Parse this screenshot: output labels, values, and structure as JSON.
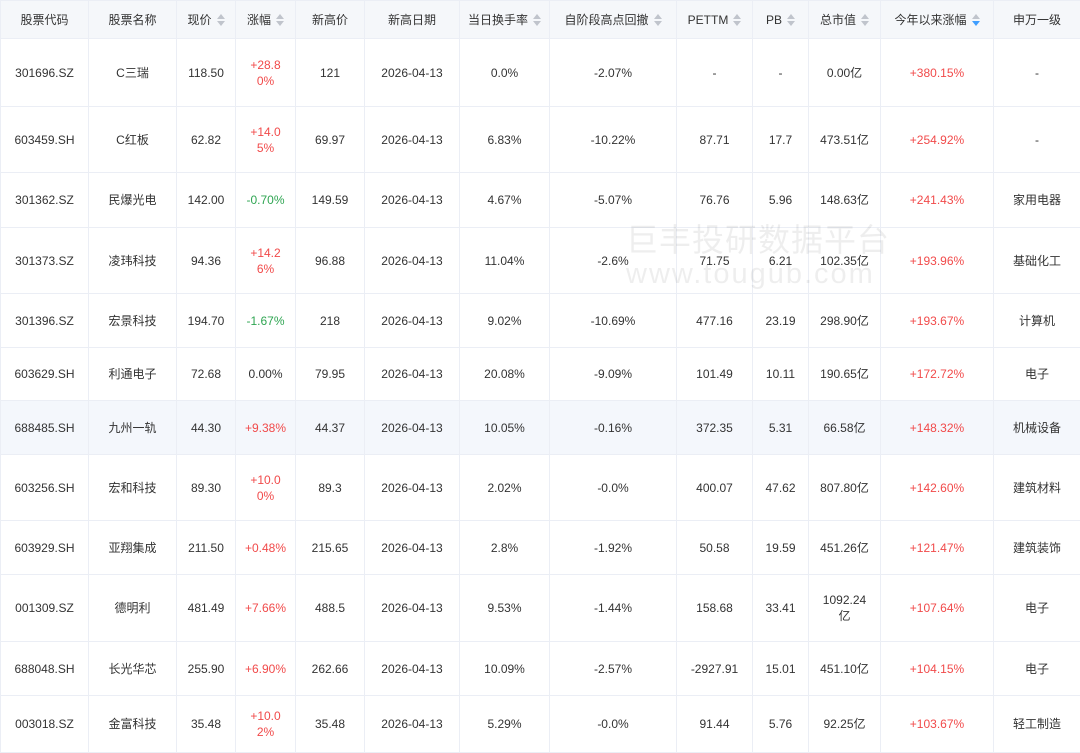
{
  "colors": {
    "up": "#f14a4a",
    "down": "#2fa552",
    "text": "#333333",
    "header_bg": "#f5f7fa",
    "border": "#ebeef5",
    "row_highlight": "#f4f7fc",
    "sort_inactive": "#c0c4cc",
    "sort_active": "#409eff"
  },
  "watermark": {
    "title": "巨丰投研数据平台",
    "url": "www.tougub.com"
  },
  "table": {
    "columns": [
      {
        "label": "股票代码",
        "sortable": false
      },
      {
        "label": "股票名称",
        "sortable": false
      },
      {
        "label": "现价",
        "sortable": true
      },
      {
        "label": "涨幅",
        "sortable": true
      },
      {
        "label": "新高价",
        "sortable": false
      },
      {
        "label": "新高日期",
        "sortable": false
      },
      {
        "label": "当日换手率",
        "sortable": true
      },
      {
        "label": "自阶段高点回撤",
        "sortable": true
      },
      {
        "label": "PETTM",
        "sortable": true
      },
      {
        "label": "PB",
        "sortable": true
      },
      {
        "label": "总市值",
        "sortable": true
      },
      {
        "label": "今年以来涨幅",
        "sortable": true,
        "sorted_descending": true
      },
      {
        "label": "申万一级",
        "sortable": false
      }
    ],
    "rows": [
      {
        "code": "301696.SZ",
        "name": "C三瑞",
        "price": "118.50",
        "change": "+28.80%",
        "high_price": "121",
        "high_date": "2026-04-13",
        "turnover": "0.0%",
        "drawdown": "-2.07%",
        "pe_ttm": "-",
        "pb": "-",
        "market_cap": "0.00亿",
        "ytd_change": "+380.15%",
        "sector": "-"
      },
      {
        "code": "603459.SH",
        "name": "C红板",
        "price": "62.82",
        "change": "+14.05%",
        "high_price": "69.97",
        "high_date": "2026-04-13",
        "turnover": "6.83%",
        "drawdown": "-10.22%",
        "pe_ttm": "87.71",
        "pb": "17.7",
        "market_cap": "473.51亿",
        "ytd_change": "+254.92%",
        "sector": "-"
      },
      {
        "code": "301362.SZ",
        "name": "民爆光电",
        "price": "142.00",
        "change": "-0.70%",
        "high_price": "149.59",
        "high_date": "2026-04-13",
        "turnover": "4.67%",
        "drawdown": "-5.07%",
        "pe_ttm": "76.76",
        "pb": "5.96",
        "market_cap": "148.63亿",
        "ytd_change": "+241.43%",
        "sector": "家用电器"
      },
      {
        "code": "301373.SZ",
        "name": "凌玮科技",
        "price": "94.36",
        "change": "+14.26%",
        "high_price": "96.88",
        "high_date": "2026-04-13",
        "turnover": "11.04%",
        "drawdown": "-2.6%",
        "pe_ttm": "71.75",
        "pb": "6.21",
        "market_cap": "102.35亿",
        "ytd_change": "+193.96%",
        "sector": "基础化工"
      },
      {
        "code": "301396.SZ",
        "name": "宏景科技",
        "price": "194.70",
        "change": "-1.67%",
        "high_price": "218",
        "high_date": "2026-04-13",
        "turnover": "9.02%",
        "drawdown": "-10.69%",
        "pe_ttm": "477.16",
        "pb": "23.19",
        "market_cap": "298.90亿",
        "ytd_change": "+193.67%",
        "sector": "计算机"
      },
      {
        "code": "603629.SH",
        "name": "利通电子",
        "price": "72.68",
        "change": "0.00%",
        "high_price": "79.95",
        "high_date": "2026-04-13",
        "turnover": "20.08%",
        "drawdown": "-9.09%",
        "pe_ttm": "101.49",
        "pb": "10.11",
        "market_cap": "190.65亿",
        "ytd_change": "+172.72%",
        "sector": "电子"
      },
      {
        "code": "688485.SH",
        "name": "九州一轨",
        "price": "44.30",
        "change": "+9.38%",
        "high_price": "44.37",
        "high_date": "2026-04-13",
        "turnover": "10.05%",
        "drawdown": "-0.16%",
        "pe_ttm": "372.35",
        "pb": "5.31",
        "market_cap": "66.58亿",
        "ytd_change": "+148.32%",
        "sector": "机械设备",
        "highlighted": true
      },
      {
        "code": "603256.SH",
        "name": "宏和科技",
        "price": "89.30",
        "change": "+10.00%",
        "high_price": "89.3",
        "high_date": "2026-04-13",
        "turnover": "2.02%",
        "drawdown": "-0.0%",
        "pe_ttm": "400.07",
        "pb": "47.62",
        "market_cap": "807.80亿",
        "ytd_change": "+142.60%",
        "sector": "建筑材料"
      },
      {
        "code": "603929.SH",
        "name": "亚翔集成",
        "price": "211.50",
        "change": "+0.48%",
        "high_price": "215.65",
        "high_date": "2026-04-13",
        "turnover": "2.8%",
        "drawdown": "-1.92%",
        "pe_ttm": "50.58",
        "pb": "19.59",
        "market_cap": "451.26亿",
        "ytd_change": "+121.47%",
        "sector": "建筑装饰"
      },
      {
        "code": "001309.SZ",
        "name": "德明利",
        "price": "481.49",
        "change": "+7.66%",
        "high_price": "488.5",
        "high_date": "2026-04-13",
        "turnover": "9.53%",
        "drawdown": "-1.44%",
        "pe_ttm": "158.68",
        "pb": "33.41",
        "market_cap": "1092.24亿",
        "ytd_change": "+107.64%",
        "sector": "电子"
      },
      {
        "code": "688048.SH",
        "name": "长光华芯",
        "price": "255.90",
        "change": "+6.90%",
        "high_price": "262.66",
        "high_date": "2026-04-13",
        "turnover": "10.09%",
        "drawdown": "-2.57%",
        "pe_ttm": "-2927.91",
        "pb": "15.01",
        "market_cap": "451.10亿",
        "ytd_change": "+104.15%",
        "sector": "电子"
      },
      {
        "code": "003018.SZ",
        "name": "金富科技",
        "price": "35.48",
        "change": "+10.02%",
        "high_price": "35.48",
        "high_date": "2026-04-13",
        "turnover": "5.29%",
        "drawdown": "-0.0%",
        "pe_ttm": "91.44",
        "pb": "5.76",
        "market_cap": "92.25亿",
        "ytd_change": "+103.67%",
        "sector": "轻工制造"
      }
    ]
  }
}
